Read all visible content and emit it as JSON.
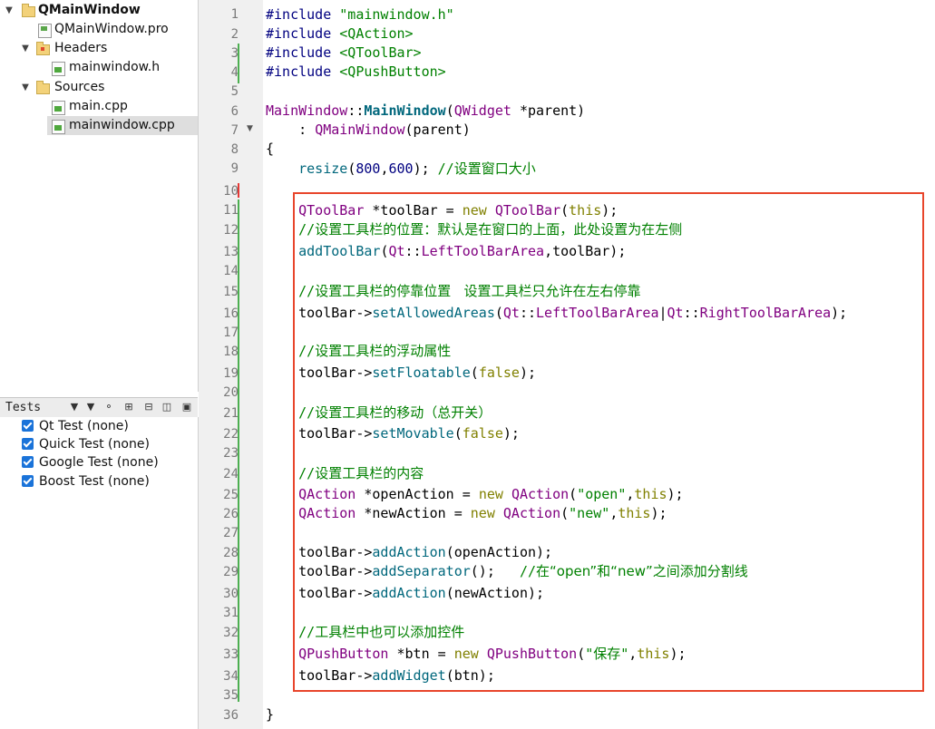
{
  "project_tree": [
    {
      "label": "QMainWindow",
      "type": "project",
      "expanded": true,
      "bold": true
    },
    {
      "label": "QMainWindow.pro",
      "type": "pro-file"
    },
    {
      "label": "Headers",
      "type": "folder",
      "expanded": true
    },
    {
      "label": "mainwindow.h",
      "type": "header-file"
    },
    {
      "label": "Sources",
      "type": "folder",
      "expanded": true
    },
    {
      "label": "main.cpp",
      "type": "source-file"
    },
    {
      "label": "mainwindow.cpp",
      "type": "source-file",
      "selected": true
    }
  ],
  "tests_panel": {
    "title": "Tests",
    "items": [
      {
        "label": "Qt Test (none)",
        "checked": true
      },
      {
        "label": "Quick Test (none)",
        "checked": true
      },
      {
        "label": "Google Test (none)",
        "checked": true
      },
      {
        "label": "Boost Test (none)",
        "checked": true
      }
    ]
  },
  "editor": {
    "line_numbers": [
      "1",
      "2",
      "3",
      "4",
      "5",
      "6",
      "7",
      "8",
      "9",
      "10",
      "11",
      "12",
      "13",
      "14",
      "15",
      "16",
      "17",
      "18",
      "19",
      "20",
      "21",
      "22",
      "23",
      "24",
      "25",
      "26",
      "27",
      "28",
      "29",
      "30",
      "31",
      "32",
      "33",
      "34",
      "35",
      "36"
    ],
    "code": {
      "l1a": "#include ",
      "l1b": "\"mainwindow.h\"",
      "l2a": "#include ",
      "l2b": "<QAction>",
      "l3a": "#include ",
      "l3b": "<QToolBar>",
      "l4a": "#include ",
      "l4b": "<QPushButton>",
      "l6a": "MainWindow",
      "l6b": "::",
      "l6c": "MainWindow",
      "l6d": "(",
      "l6e": "QWidget",
      "l6f": " *parent)",
      "l7a": "    : ",
      "l7b": "QMainWindow",
      "l7c": "(parent)",
      "l8": "{",
      "l9a": "    ",
      "l9b": "resize",
      "l9c": "(",
      "l9d": "800",
      "l9e": ",",
      "l9f": "600",
      "l9g": "); ",
      "l9h": "//",
      "l9i": "设置窗口大小",
      "l11a": "    ",
      "l11b": "QToolBar",
      "l11c": " *toolBar = ",
      "l11d": "new ",
      "l11e": "QToolBar",
      "l11f": "(",
      "l11g": "this",
      "l11h": ");",
      "l12a": "    ",
      "l12b": "//",
      "l12c": "设置工具栏的位置：默认是在窗口的上面，此处设置为在左侧",
      "l13a": "    ",
      "l13b": "addToolBar",
      "l13c": "(",
      "l13d": "Qt",
      "l13e": "::",
      "l13f": "LeftToolBarArea",
      "l13g": ",toolBar);",
      "l15a": "    ",
      "l15b": "//",
      "l15c": "设置工具栏的停靠位置   设置工具栏只允许在左右停靠",
      "l16a": "    toolBar->",
      "l16b": "setAllowedAreas",
      "l16c": "(",
      "l16d": "Qt",
      "l16e": "::",
      "l16f": "LeftToolBarArea",
      "l16g": "|",
      "l16h": "Qt",
      "l16i": "::",
      "l16j": "RightToolBarArea",
      "l16k": ");",
      "l18a": "    ",
      "l18b": "//",
      "l18c": "设置工具栏的浮动属性",
      "l19a": "    toolBar->",
      "l19b": "setFloatable",
      "l19c": "(",
      "l19d": "false",
      "l19e": ");",
      "l21a": "    ",
      "l21b": "//",
      "l21c": "设置工具栏的移动（总开关）",
      "l22a": "    toolBar->",
      "l22b": "setMovable",
      "l22c": "(",
      "l22d": "false",
      "l22e": ");",
      "l24a": "    ",
      "l24b": "//",
      "l24c": "设置工具栏的内容",
      "l25a": "    ",
      "l25b": "QAction",
      "l25c": " *openAction = ",
      "l25d": "new ",
      "l25e": "QAction",
      "l25f": "(",
      "l25g": "\"open\"",
      "l25h": ",",
      "l25i": "this",
      "l25j": ");",
      "l26a": "    ",
      "l26b": "QAction",
      "l26c": " *newAction = ",
      "l26d": "new ",
      "l26e": "QAction",
      "l26f": "(",
      "l26g": "\"new\"",
      "l26h": ",",
      "l26i": "this",
      "l26j": ");",
      "l28a": "    toolBar->",
      "l28b": "addAction",
      "l28c": "(openAction);",
      "l29a": "    toolBar->",
      "l29b": "addSeparator",
      "l29c": "();   ",
      "l29d": "//",
      "l29e": "在“open”和“new”之间添加分割线",
      "l30a": "    toolBar->",
      "l30b": "addAction",
      "l30c": "(newAction);",
      "l32a": "    ",
      "l32b": "//",
      "l32c": "工具栏中也可以添加控件",
      "l33a": "    ",
      "l33b": "QPushButton",
      "l33c": " *btn = ",
      "l33d": "new ",
      "l33e": "QPushButton",
      "l33f": "(",
      "l33g": "\"保存\"",
      "l33h": ",",
      "l33i": "this",
      "l33j": ");",
      "l34a": "    toolBar->",
      "l34b": "addWidget",
      "l34c": "(btn);",
      "l36": "}"
    }
  },
  "colors": {
    "highlight_box": "#e8452b",
    "change_marker": "#4caf50",
    "checkbox": "#1a73d9"
  }
}
